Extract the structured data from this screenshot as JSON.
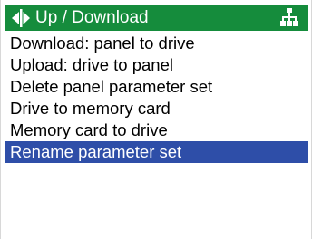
{
  "header": {
    "title": "Up / Download",
    "left_icon": "up-down-arrows-icon",
    "right_icon": "hierarchy-icon",
    "background_color": "#158c3c"
  },
  "menu": {
    "selected_index": 5,
    "selected_color": "#2e4ea8",
    "items": [
      {
        "label": "Download: panel to drive"
      },
      {
        "label": "Upload: drive to panel"
      },
      {
        "label": "Delete panel parameter set"
      },
      {
        "label": "Drive to memory card"
      },
      {
        "label": "Memory card to drive"
      },
      {
        "label": "Rename parameter set"
      }
    ]
  }
}
